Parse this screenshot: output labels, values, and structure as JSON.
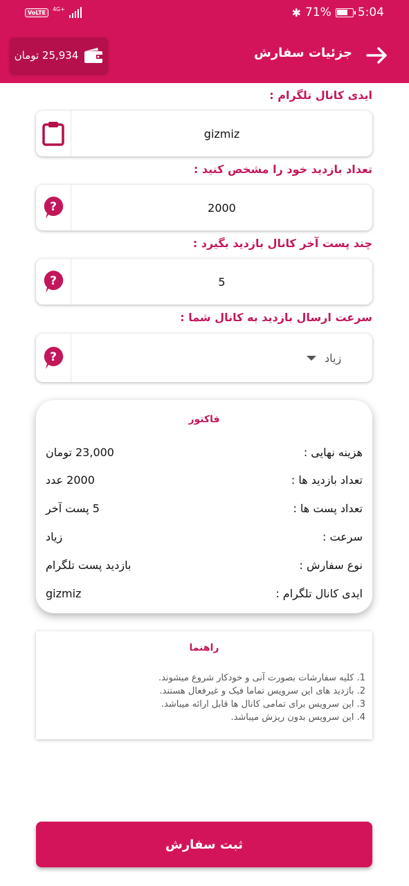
{
  "status_bar": {
    "volte": "VoLTE",
    "network": "4G+",
    "battery_percent": "71%",
    "battery_level": 0.71,
    "time": "5:04"
  },
  "appbar": {
    "title": "جزئیات سفارش",
    "wallet_amount": "25,934 تومان",
    "back_icon": "arrow-right-icon",
    "wallet_icon": "wallet-icon"
  },
  "form": {
    "channel_id": {
      "label": "ایدی کانال تلگرام :",
      "value": "gizmiz",
      "icon": "clipboard-icon"
    },
    "view_count": {
      "label": "تعداد بازدید خود را مشخص کنید :",
      "value": "2000",
      "icon": "help-icon"
    },
    "post_count": {
      "label": "چند پست آخر کانال بازدید بگیرد :",
      "value": "5",
      "icon": "help-icon"
    },
    "speed": {
      "label": "سرعت ارسال بازدید به کانال شما :",
      "value": "زیاد",
      "icon": "help-icon"
    }
  },
  "invoice": {
    "title": "فاکتور",
    "rows": [
      {
        "label": "هزینه نهایی :",
        "value": "23,000 تومان"
      },
      {
        "label": "تعداد بازدید ها :",
        "value": "2000 عدد"
      },
      {
        "label": "تعداد پست ها :",
        "value": "5 پست آخر"
      },
      {
        "label": "سرعت :",
        "value": "زیاد"
      },
      {
        "label": "نوع سفارش :",
        "value": "بازدید پست تلگرام"
      },
      {
        "label": "ایدی کانال تلگرام :",
        "value": "gizmiz"
      }
    ]
  },
  "guide": {
    "title": "راهنما",
    "items": [
      "1. کلیه سفارشات بصورت آنی و خودکار شروع میشوند.",
      "2. بازدید های این سرویس تماما فیک و غیرفعال هستند.",
      "3. این سرویس برای تمامی کانال ها قابل ارائه میباشد.",
      "4. این سرویس بدون ریزش میباشد."
    ]
  },
  "submit": {
    "label": "ثبت سفارش"
  },
  "colors": {
    "primary": "#D4145A",
    "primary_dark": "#B5104C",
    "accent_text": "#C2185B"
  }
}
